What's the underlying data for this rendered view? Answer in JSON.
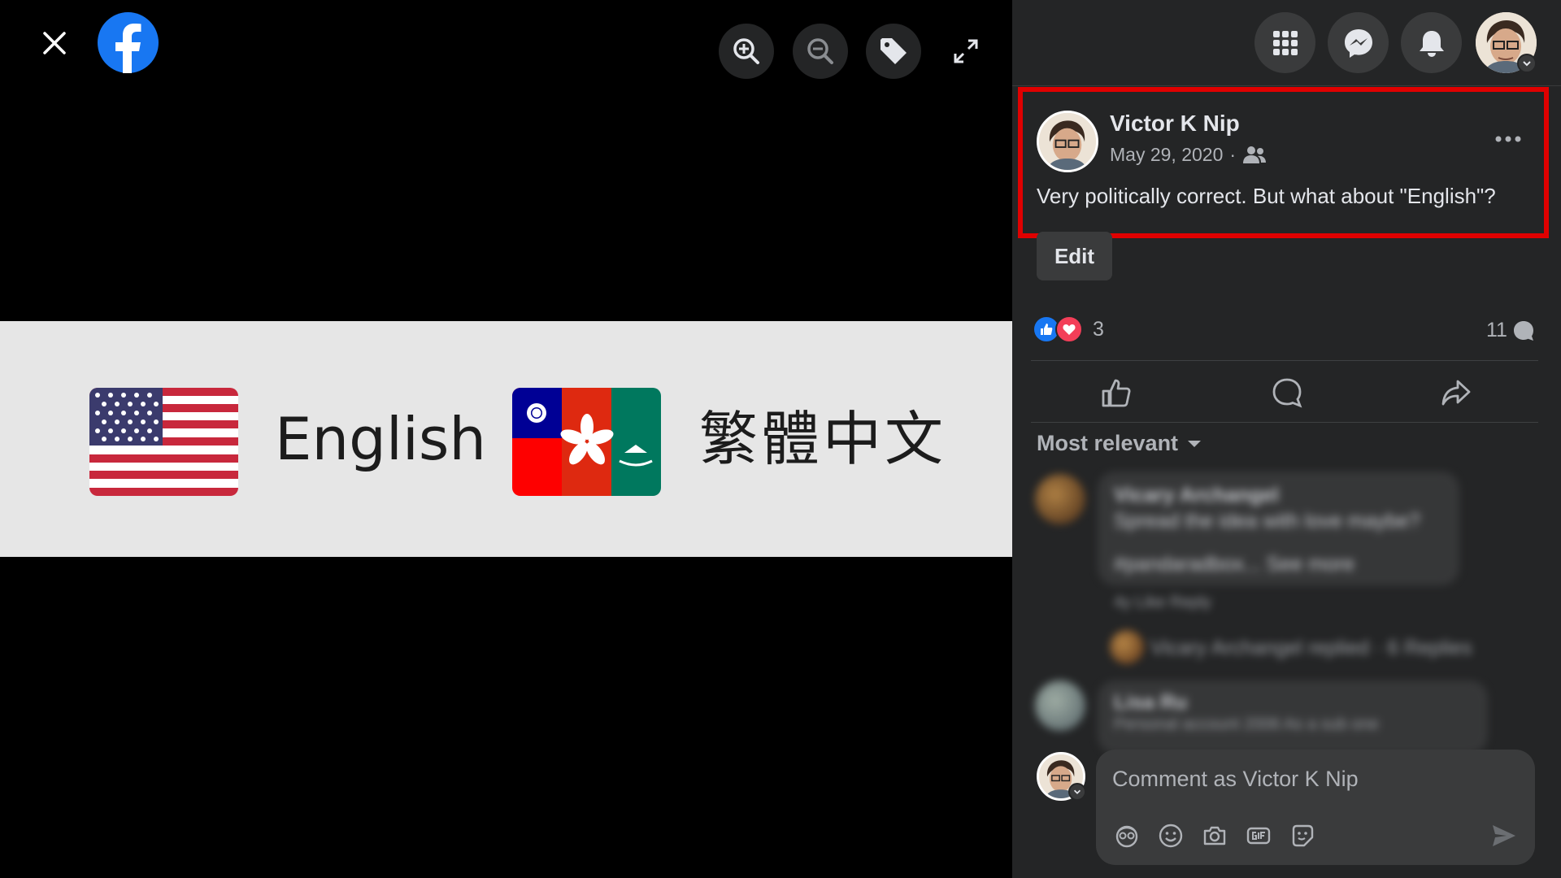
{
  "viewer": {
    "tools": [
      "zoom-in",
      "zoom-out",
      "tag",
      "fullscreen"
    ],
    "image": {
      "label_en": "English",
      "label_zh": "繁體中文"
    }
  },
  "topnav": {
    "icons": [
      "grid-menu-icon",
      "messenger-icon",
      "bell-icon"
    ]
  },
  "post": {
    "author": "Victor K Nip",
    "date": "May 29, 2020",
    "date_sep": "·",
    "text": "Very politically correct. But what about \"English\"?",
    "edit_label": "Edit",
    "reaction_count": "3",
    "comment_count": "11",
    "sort_label": "Most relevant"
  },
  "blurred_comments": {
    "c1_name": "Vicary Archangel",
    "c1_text": "Spread the idea with love maybe?",
    "c1_tags": "#pandaradbox... See more",
    "c1_actions": "4y   Like   Reply",
    "c1_replies": "Vicary Archangel replied · 6 Replies",
    "c2_name": "Lisa Ru",
    "c2_text": "Personal account   2006   As a sub one"
  },
  "composer": {
    "placeholder": "Comment as Victor K Nip"
  },
  "colors": {
    "accent": "#1877f2",
    "panel": "#242526",
    "highlight": "#e00000",
    "love": "#f33e58"
  }
}
